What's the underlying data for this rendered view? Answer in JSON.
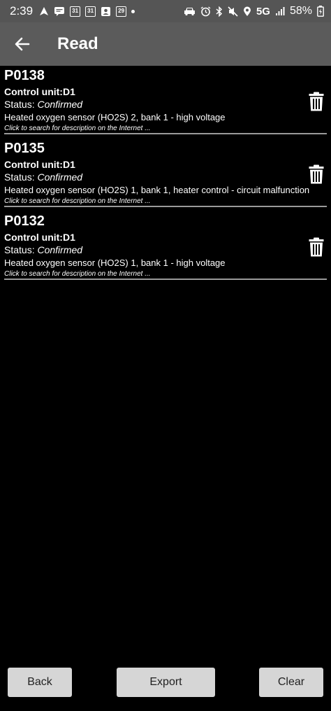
{
  "status_bar": {
    "time": "2:39",
    "cal_day_1": "31",
    "cal_day_2": "31",
    "cal_day_3": "29",
    "network": "5G",
    "battery": "58%"
  },
  "app_bar": {
    "title": "Read"
  },
  "faults": [
    {
      "code": "P0138",
      "control_unit": "Control unit:D1",
      "status_label": "Status: ",
      "status_value": "Confirmed",
      "description": "Heated oxygen sensor (HO2S) 2, bank 1 - high voltage",
      "link_text": "Click to search for description on the Internet ..."
    },
    {
      "code": "P0135",
      "control_unit": "Control unit:D1",
      "status_label": "Status: ",
      "status_value": "Confirmed",
      "description": "Heated oxygen sensor (HO2S) 1, bank 1, heater control - circuit malfunction",
      "link_text": "Click to search for description on the Internet ..."
    },
    {
      "code": "P0132",
      "control_unit": "Control unit:D1",
      "status_label": "Status: ",
      "status_value": "Confirmed",
      "description": "Heated oxygen sensor (HO2S) 1, bank 1 - high voltage",
      "link_text": "Click to search for description on the Internet ..."
    }
  ],
  "buttons": {
    "back": "Back",
    "export": "Export",
    "clear": "Clear"
  },
  "icons": {
    "back": "arrow-left-icon",
    "delete": "trash-icon"
  },
  "colors": {
    "status_bar_bg": "#555555",
    "app_bar_bg": "#5b5b5b",
    "background": "#000000",
    "button_bg": "#d6d6d6",
    "divider": "#9a9a9a"
  }
}
